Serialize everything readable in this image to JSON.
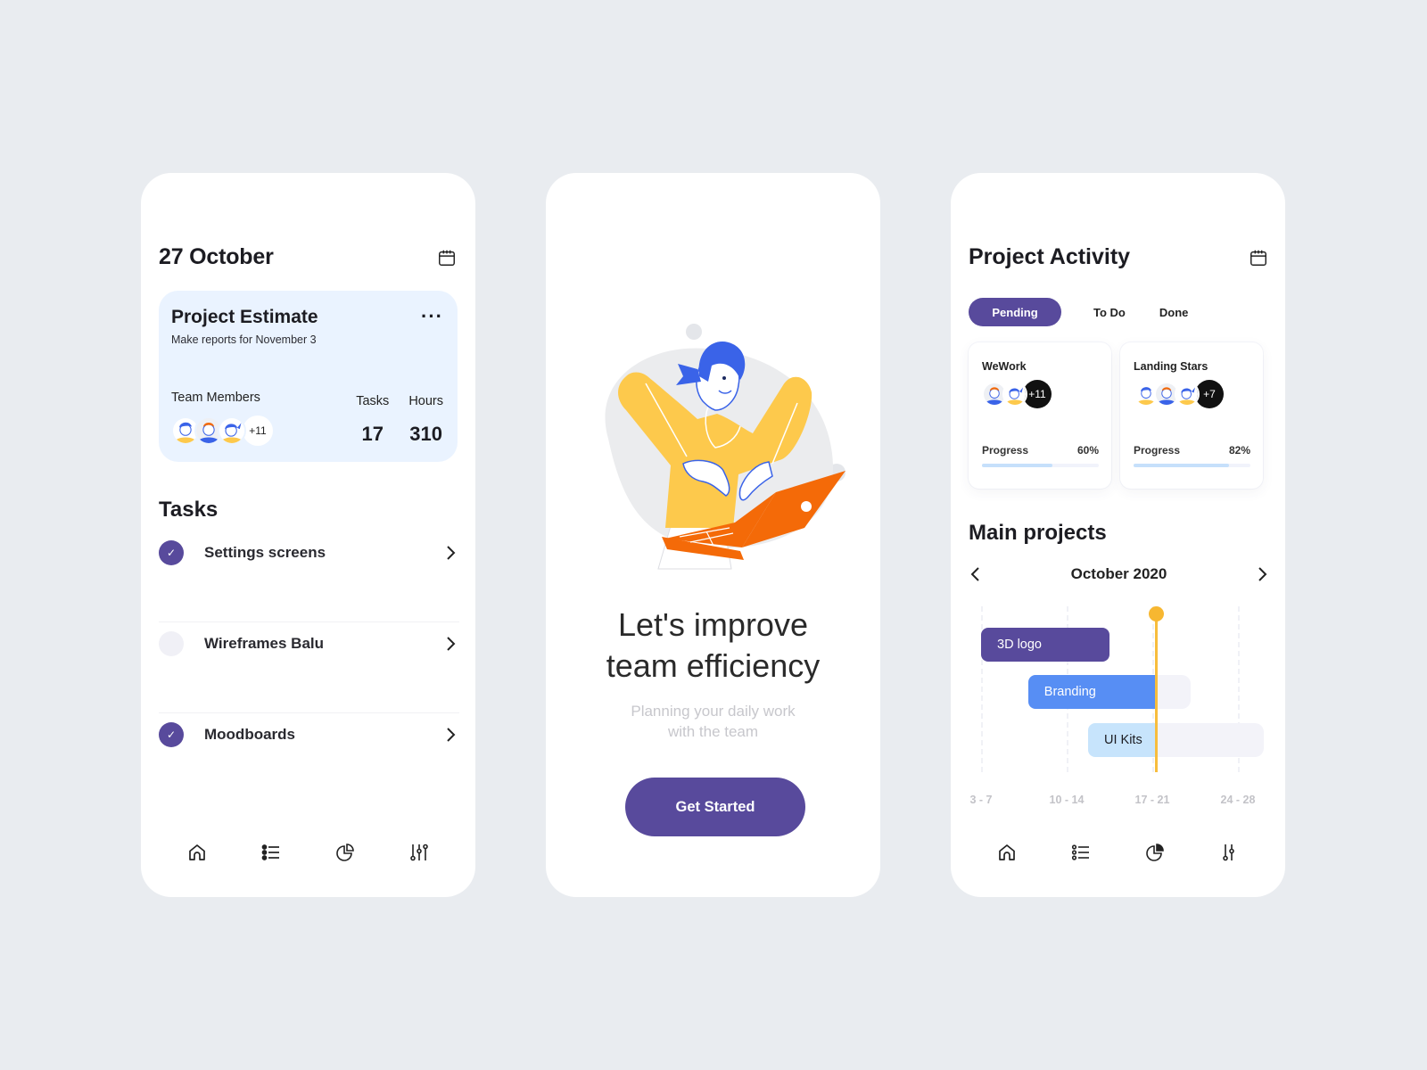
{
  "colors": {
    "page_bg": "#e9ecf0",
    "accent_purple": "#584a9c",
    "accent_blue": "#578ef4",
    "light_blue": "#c7e4fc",
    "today_yellow": "#f7b731",
    "card_bg": "#eaf3ff",
    "illustration_orange": "#f46a08",
    "illustration_yellow": "#fdc94c",
    "illustration_hair_blue": "#3a63e8"
  },
  "screen1": {
    "date_title": "27 October",
    "calendar_icon": "calendar-icon",
    "estimate_card": {
      "title": "Project Estimate",
      "subtitle": "Make reports for November 3",
      "more_icon": "more-horizontal-icon",
      "team_members_label": "Team Members",
      "team_extra": "+11",
      "tasks_label": "Tasks",
      "tasks_value": "17",
      "hours_label": "Hours",
      "hours_value": "310"
    },
    "tasks_title": "Tasks",
    "tasks": [
      {
        "label": "Settings screens",
        "done": true
      },
      {
        "label": "Wireframes Balu",
        "done": false
      },
      {
        "label": "Moodboards",
        "done": true
      }
    ],
    "tabbar": [
      "home-icon",
      "list-icon",
      "pie-chart-icon",
      "sliders-icon"
    ],
    "active_tab": "list-icon"
  },
  "screen2": {
    "illustration": "woman-with-laptop-illustration",
    "title_line1": "Let's improve",
    "title_line2": "team efficiency",
    "subtitle_line1": "Planning your daily work",
    "subtitle_line2": "with the team",
    "cta_label": "Get Started"
  },
  "screen3": {
    "title": "Project Activity",
    "calendar_icon": "calendar-icon",
    "segments": [
      {
        "label": "Pending",
        "active": true
      },
      {
        "label": "To Do",
        "active": false
      },
      {
        "label": "Done",
        "active": false
      }
    ],
    "projects": [
      {
        "name": "WeWork",
        "extra": "+11",
        "progress_label": "Progress",
        "progress_text": "60%",
        "progress": 0.6
      },
      {
        "name": "Landing Stars",
        "extra": "+7",
        "progress_label": "Progress",
        "progress_text": "82%",
        "progress": 0.82
      }
    ],
    "main_projects_title": "Main projects",
    "month_label": "October 2020",
    "weeks": [
      "3 - 7",
      "10 - 14",
      "17 - 21",
      "24 - 28"
    ],
    "gantt": [
      {
        "label": "3D logo",
        "start_week": 0.0,
        "end_week": 1.5,
        "done_until": 1.5,
        "color": "#584a9c",
        "text_color": "#ffffff"
      },
      {
        "label": "Branding",
        "start_week": 0.55,
        "end_week": 2.45,
        "done_until": 2.05,
        "color": "#578ef4",
        "text_color": "#ffffff"
      },
      {
        "label": "UI Kits",
        "start_week": 1.25,
        "end_week": 3.3,
        "done_until": 2.05,
        "color": "#c7e4fc",
        "text_color": "#1c1c22"
      }
    ],
    "today_week": 2.05,
    "tabbar": [
      "home-icon",
      "list-icon",
      "pie-chart-icon",
      "sliders-icon"
    ],
    "active_tab": "pie-chart-icon"
  }
}
